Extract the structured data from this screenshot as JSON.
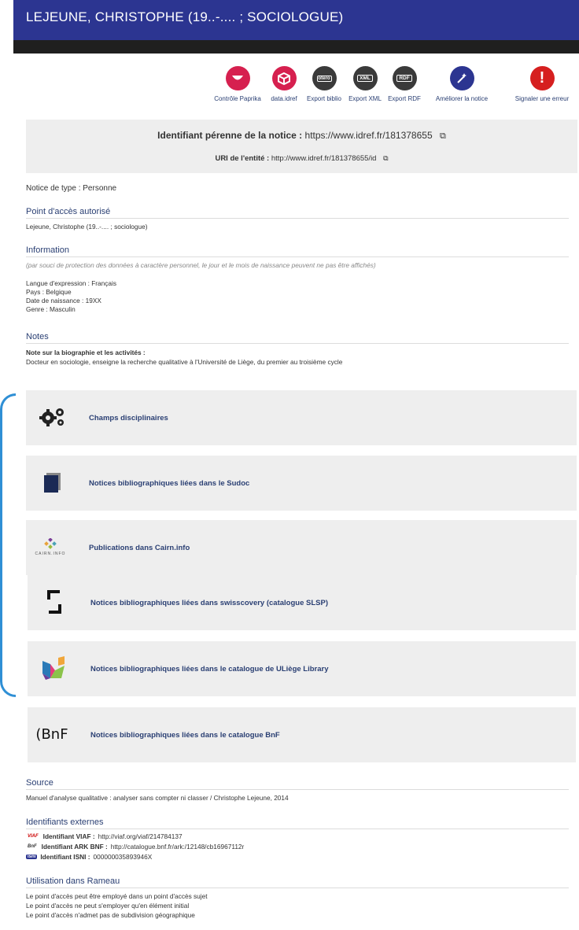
{
  "header": {
    "title": "LEJEUNE, CHRISTOPHE (19..-.... ; SOCIOLOGUE)"
  },
  "toolbar": [
    {
      "label": "Contrôle Paprika",
      "icon": "paprika-smile-icon",
      "color": "#d6204f"
    },
    {
      "label": "data.idref",
      "icon": "data-cube-icon",
      "color": "#d6204f"
    },
    {
      "label": "Export biblio",
      "icon": "zotero-icon",
      "color": "#3a3a3a"
    },
    {
      "label": "Export XML",
      "icon": "xml-icon",
      "color": "#3a3a3a"
    },
    {
      "label": "Export RDF",
      "icon": "rdf-icon",
      "color": "#3a3a3a"
    },
    {
      "label": "Améliorer la notice",
      "icon": "magic-wand-icon",
      "color": "#2c3591"
    },
    {
      "label": "Signaler une erreur",
      "icon": "exclamation-icon",
      "color": "#d61f1f"
    }
  ],
  "identifier": {
    "label": "Identifiant pérenne de la notice :",
    "value": "https://www.idref.fr/181378655",
    "uri_label": "URI de l'entité :",
    "uri_value": "http://www.idref.fr/181378655/id"
  },
  "notice_type": {
    "label": "Notice de type :",
    "value": "Personne"
  },
  "point_acces": {
    "title": "Point d'accès autorisé",
    "value": "Lejeune, Christophe (19..-.... ; sociologue)"
  },
  "information": {
    "title": "Information",
    "note": "(par souci de protection des données à caractère personnel, le jour et le mois de naissance peuvent ne pas être affichés)",
    "rows": [
      "Langue d'expression : Français",
      "Pays : Belgique",
      "Date de naissance :   19XX",
      "Genre : Masculin"
    ]
  },
  "notes": {
    "title": "Notes",
    "subtitle": "Note sur la biographie et les activités :",
    "text": "Docteur en sociologie, enseigne la recherche qualitative à l'Université de Liège, du premier au troisième cycle"
  },
  "panels": [
    {
      "label": "Champs disciplinaires",
      "icon": "gears-icon"
    },
    {
      "label": "Notices bibliographiques liées dans le Sudoc",
      "icon": "sudoc-book-icon"
    },
    {
      "label": "Publications dans Cairn.info",
      "icon": "cairn-logo-icon",
      "logo_text": "CAIRN.INFO"
    },
    {
      "label": "Notices bibliographiques liées dans swisscovery (catalogue SLSP)",
      "icon": "swisscovery-logo-icon"
    },
    {
      "label": "Notices bibliographiques liées dans le catalogue de ULiège Library",
      "icon": "uliege-logo-icon"
    },
    {
      "label": "Notices bibliographiques liées dans le catalogue BnF",
      "icon": "bnf-logo-icon",
      "logo_text": "(BnF"
    }
  ],
  "source": {
    "title": "Source",
    "text": "Manuel d'analyse qualitative : analyser sans compter ni classer / Christophe Lejeune, 2014"
  },
  "external_ids": {
    "title": "Identifiants externes",
    "rows": [
      {
        "badge": "VIAF",
        "label": "Identifiant VIAF :",
        "value": "http://viaf.org/viaf/214784137"
      },
      {
        "badge": "BnF",
        "label": "Identifiant ARK BNF :",
        "value": "http://catalogue.bnf.fr/ark:/12148/cb16967112r"
      },
      {
        "badge": "isni",
        "label": "Identifiant ISNI :",
        "value": "000000035893946X"
      }
    ]
  },
  "rameau": {
    "title": "Utilisation dans Rameau",
    "rows": [
      "Le point d'accès peut être employé dans un point d'accès sujet",
      "Le point d'accès ne peut s'employer qu'en élément initial",
      "Le point d'accès n'admet pas de subdivision géographique"
    ]
  }
}
